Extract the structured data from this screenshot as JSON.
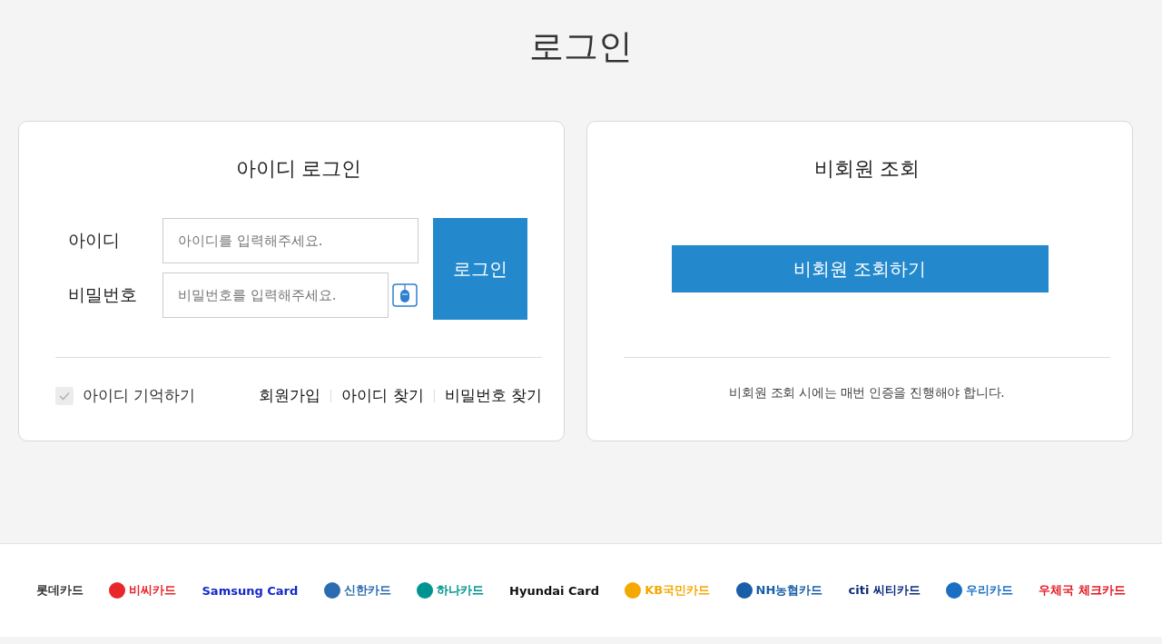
{
  "page_title": "로그인",
  "id_login": {
    "title": "아이디 로그인",
    "fields": [
      {
        "label": "아이디",
        "placeholder": "아이디를 입력해주세요.",
        "kind": "text"
      },
      {
        "label": "비밀번호",
        "placeholder": "비밀번호를 입력해주세요.",
        "kind": "password"
      }
    ],
    "submit": "로그인",
    "remember": {
      "label": "아이디 기억하기",
      "checked": false
    },
    "links": [
      "회원가입",
      "아이디 찾기",
      "비밀번호 찾기"
    ]
  },
  "guest": {
    "title": "비회원 조회",
    "button": "비회원 조회하기",
    "note": "비회원 조회 시에는 매번 인증을 진행해야 합니다."
  },
  "card_logos": [
    {
      "text": "롯데카드",
      "color": "#333333",
      "emblem": false
    },
    {
      "text": "비씨카드",
      "color": "#e8262b",
      "emblem": true
    },
    {
      "text": "Samsung Card",
      "color": "#1428c8",
      "emblem": false
    },
    {
      "text": "신한카드",
      "color": "#2b6cb0",
      "emblem": true
    },
    {
      "text": "하나카드",
      "color": "#009490",
      "emblem": true
    },
    {
      "text": "Hyundai Card",
      "color": "#111111",
      "emblem": false
    },
    {
      "text": "KB국민카드",
      "color": "#f5a800",
      "emblem": true
    },
    {
      "text": "NH농협카드",
      "color": "#1a5ea8",
      "emblem": true
    },
    {
      "text": "citi 씨티카드",
      "color": "#0b2a7a",
      "emblem": false
    },
    {
      "text": "우리카드",
      "color": "#1a6fc4",
      "emblem": true
    },
    {
      "text": "우체국 체크카드",
      "color": "#e3141b",
      "emblem": false
    }
  ]
}
